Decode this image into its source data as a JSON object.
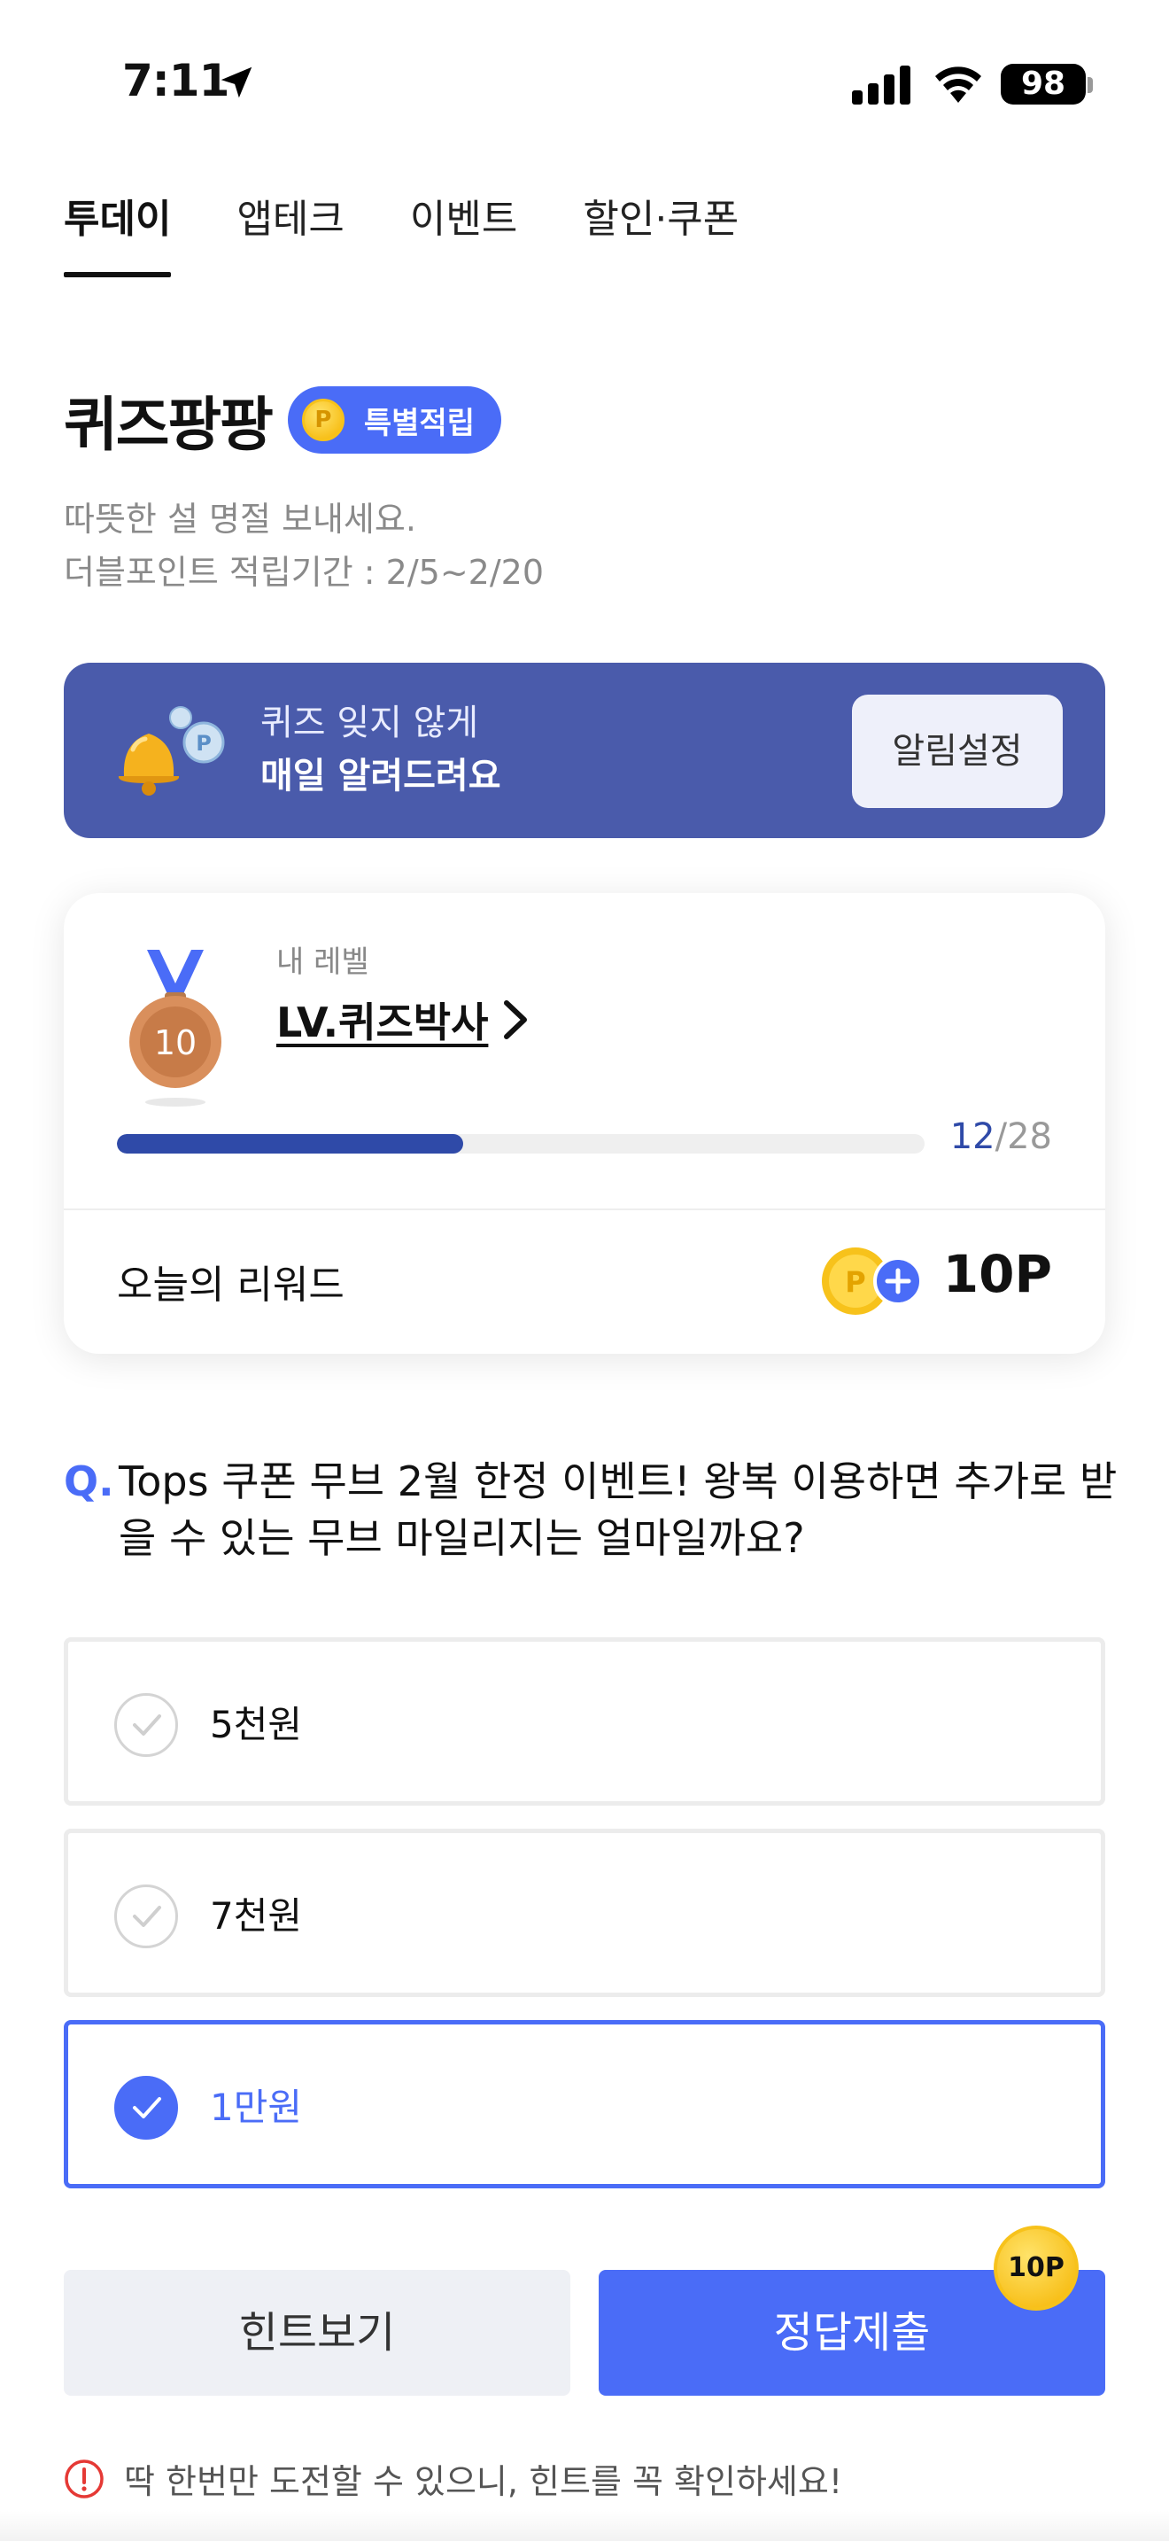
{
  "status_bar": {
    "time": "7:11",
    "battery": "98"
  },
  "tabs": [
    {
      "label": "투데이",
      "active": true
    },
    {
      "label": "앱테크",
      "active": false
    },
    {
      "label": "이벤트",
      "active": false
    },
    {
      "label": "할인·쿠폰",
      "active": false
    }
  ],
  "header": {
    "title": "퀴즈팡팡",
    "badge": "특별적립",
    "badge_coin": "P",
    "subtitle_line1": "따뜻한 설 명절 보내세요.",
    "subtitle_line2": "더블포인트 적립기간 : 2/5~2/20"
  },
  "notify": {
    "line1": "퀴즈 잊지 않게",
    "line2": "매일 알려드려요",
    "button": "알림설정"
  },
  "level_card": {
    "medal_number": "10",
    "label": "내 레벨",
    "level_name": "LV.퀴즈박사",
    "progress_current": "12",
    "progress_total": "/28",
    "progress_fraction": 0.4286,
    "reward_label": "오늘의 리워드",
    "reward_value": "10P"
  },
  "question": {
    "prefix": "Q.",
    "text": "Tops 쿠폰 무브 2월 한정 이벤트! 왕복 이용하면 추가로 받을 수 있는 무브 마일리지는 얼마일까요?"
  },
  "options": [
    {
      "label": "5천원",
      "selected": false
    },
    {
      "label": "7천원",
      "selected": false
    },
    {
      "label": "1만원",
      "selected": true
    }
  ],
  "actions": {
    "hint": "힌트보기",
    "submit": "정답제출",
    "point_badge": "10P"
  },
  "warning": "딱 한번만 도전할 수 있으니, 힌트를 꼭 확인하세요!",
  "colors": {
    "accent": "#4a6cf7",
    "banner": "#4a5bab",
    "progress": "#2f4aa8",
    "coin": "#f5b400"
  }
}
